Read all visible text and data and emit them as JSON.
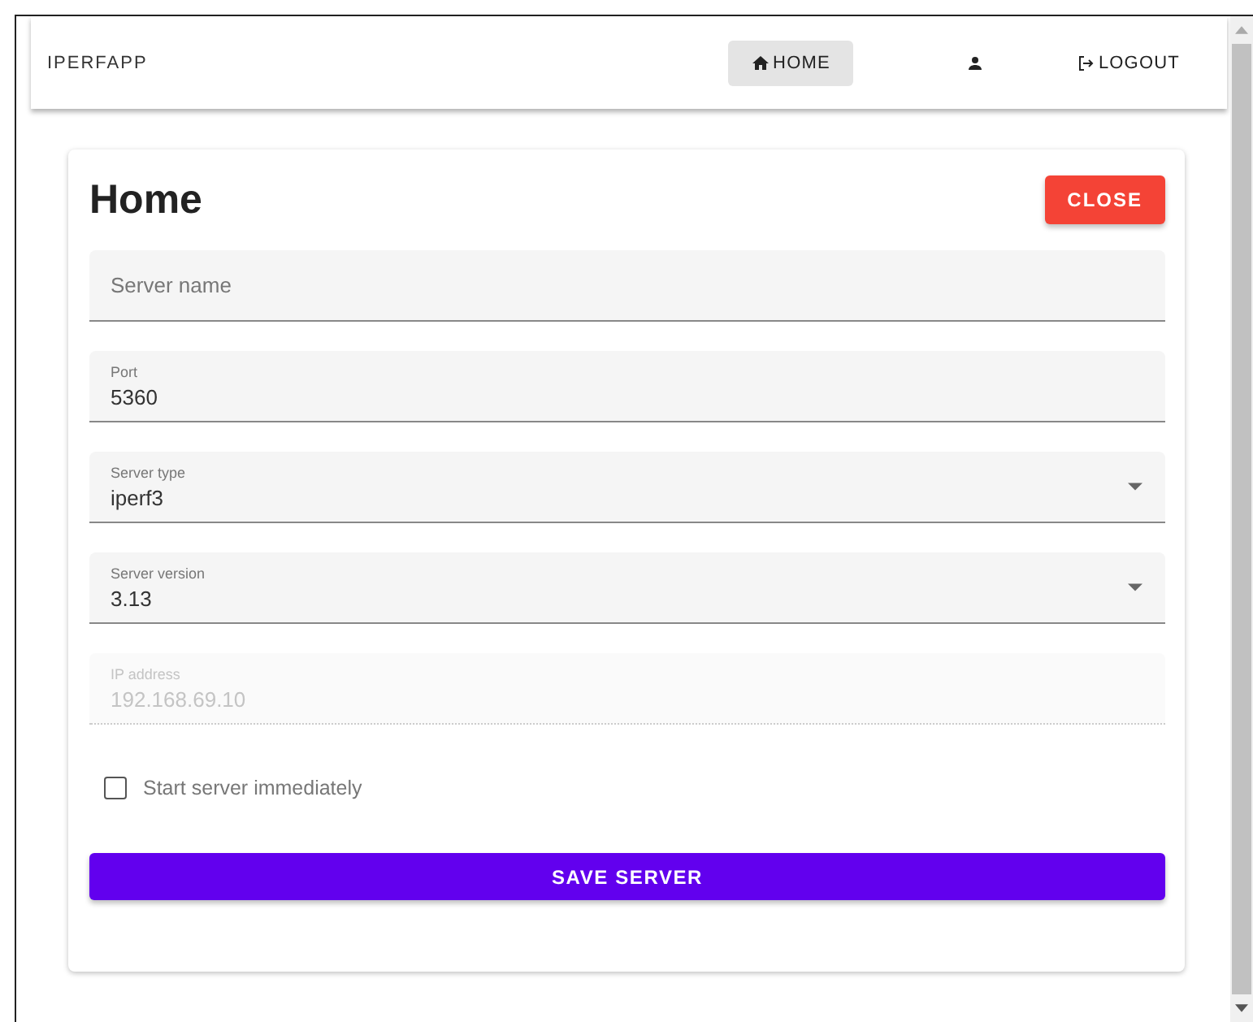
{
  "navbar": {
    "brand": "IPERFAPP",
    "items": [
      {
        "kind": "home",
        "label": "HOME",
        "selected": true
      },
      {
        "kind": "user",
        "selected": false
      },
      {
        "kind": "logout",
        "label": "LOGOUT",
        "selected": false
      }
    ]
  },
  "card": {
    "title": "Home",
    "close_button": "CLOSE",
    "fields": [
      {
        "kind": "text",
        "placeholder": "Server name",
        "disabled": false
      },
      {
        "kind": "text",
        "label": "Port",
        "value": "5360",
        "disabled": false
      },
      {
        "kind": "select",
        "label": "Server type",
        "value": "iperf3",
        "disabled": false
      },
      {
        "kind": "select",
        "label": "Server version",
        "value": "3.13",
        "disabled": false
      },
      {
        "kind": "text",
        "label": "IP address",
        "value": "192.168.69.10",
        "disabled": true
      }
    ],
    "checkbox": {
      "label": "Start server immediately",
      "checked": false
    },
    "save_button": "SAVE SERVER"
  }
}
